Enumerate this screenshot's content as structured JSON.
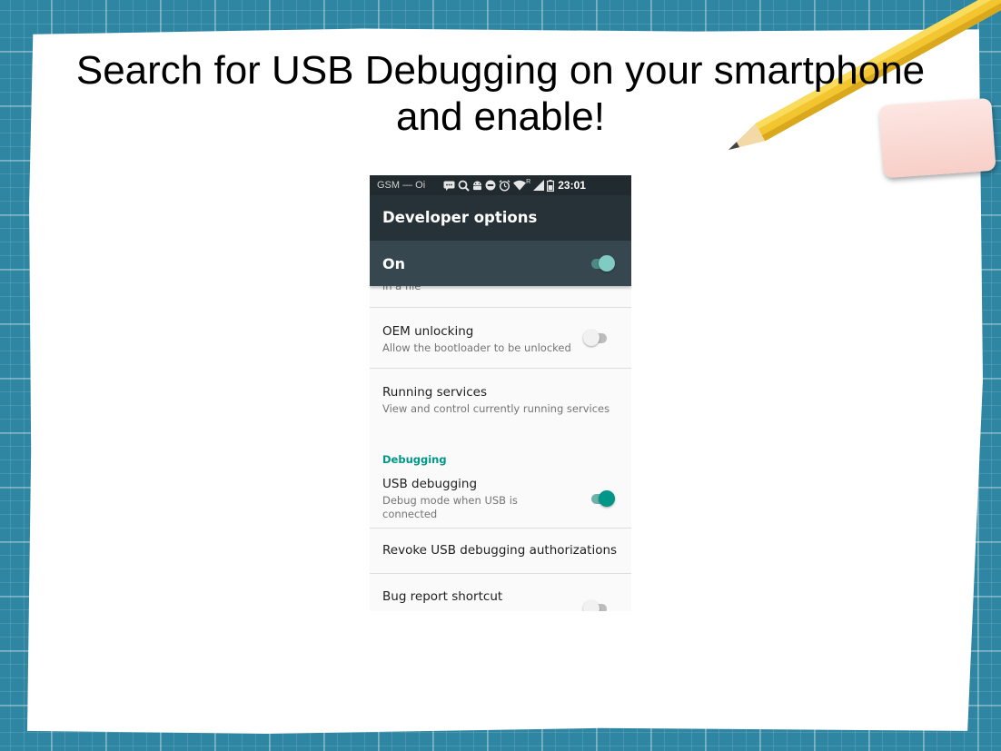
{
  "slide": {
    "title_line1": "Search for USB Debugging on your smartphone",
    "title_line2": "and enable!"
  },
  "phone": {
    "status_bar": {
      "carrier": "GSM — Oi",
      "roaming_indicator": "R",
      "time": "23:01",
      "icons": [
        "message-icon",
        "search-icon",
        "android-icon",
        "do-not-disturb-icon",
        "alarm-icon",
        "wifi-icon",
        "signal-icon",
        "battery-icon"
      ]
    },
    "app_bar": {
      "title": "Developer options"
    },
    "master_switch": {
      "label": "On",
      "state": "on"
    },
    "partial_item_summary": "in a file",
    "items": [
      {
        "title": "OEM unlocking",
        "summary": "Allow the bootloader to be unlocked",
        "toggle": "off"
      },
      {
        "title": "Running services",
        "summary": "View and control currently running services"
      }
    ],
    "section_debugging": "Debugging",
    "usb_debugging": {
      "title": "USB debugging",
      "summary_line1": "Debug mode when USB is",
      "summary_line2": "connected",
      "toggle": "on"
    },
    "revoke_item": {
      "title": "Revoke USB debugging authorizations"
    },
    "bug_report": {
      "title": "Bug report shortcut",
      "toggle": "off"
    },
    "colors": {
      "accent": "#009688",
      "app_bar": "#263238",
      "master_bar": "#37474f",
      "status_bar": "#212a2e"
    }
  }
}
